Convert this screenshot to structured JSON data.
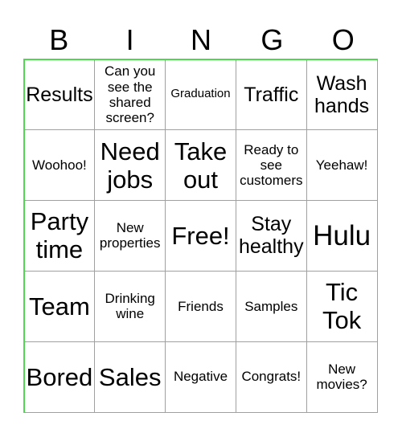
{
  "header": {
    "letters": [
      "B",
      "I",
      "N",
      "G",
      "O"
    ]
  },
  "grid": {
    "rows": [
      [
        "Results",
        "Can you see the shared screen?",
        "Graduation",
        "Traffic",
        "Wash hands"
      ],
      [
        "Woohoo!",
        "Need jobs",
        "Take out",
        "Ready to see customers",
        "Yeehaw!"
      ],
      [
        "Party time",
        "New properties",
        "Free!",
        "Stay healthy",
        "Hulu"
      ],
      [
        "Team",
        "Drinking wine",
        "Friends",
        "Samples",
        "Tic Tok"
      ],
      [
        "Bored",
        "Sales",
        "Negative",
        "Congrats!",
        "New movies?"
      ]
    ]
  },
  "colors": {
    "grid_line": "#4fd94f",
    "text": "#000000",
    "background": "#ffffff"
  }
}
